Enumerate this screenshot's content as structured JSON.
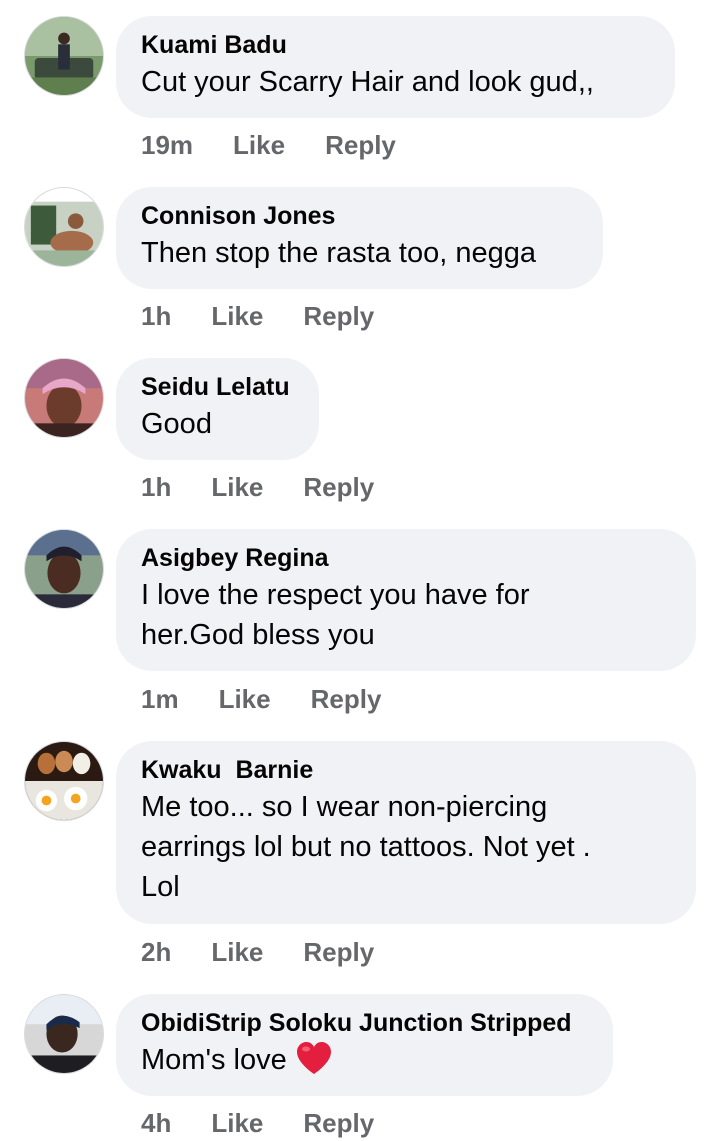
{
  "comments": [
    {
      "author": "Kuami Badu",
      "text": "Cut your Scarry Hair and look gud,,",
      "time": "19m",
      "like_label": "Like",
      "reply_label": "Reply",
      "avatar_desc": "man-standing-by-car-avatar"
    },
    {
      "author": "Connison Jones",
      "text": "Then stop the rasta too, negga",
      "time": "1h",
      "like_label": "Like",
      "reply_label": "Reply",
      "avatar_desc": "person-sitting-avatar"
    },
    {
      "author": "Seidu Lelatu",
      "text": "Good",
      "time": "1h",
      "like_label": "Like",
      "reply_label": "Reply",
      "avatar_desc": "woman-headwrap-avatar"
    },
    {
      "author": "Asigbey Regina",
      "text_lines": [
        "I love the respect you have for",
        "her.God bless you"
      ],
      "time": "1m",
      "like_label": "Like",
      "reply_label": "Reply",
      "avatar_desc": "woman-portrait-avatar"
    },
    {
      "author": "Kwaku  Barnie",
      "text_lines": [
        "Me too... so I wear non-piercing",
        "earrings lol but no tattoos. Not yet .",
        "Lol"
      ],
      "time": "2h",
      "like_label": "Like",
      "reply_label": "Reply",
      "avatar_desc": "eggs-avatar"
    },
    {
      "author": "ObidiStrip Soloku Junction Stripped",
      "text": "Mom's love",
      "emoji": "heart-icon",
      "time": "4h",
      "like_label": "Like",
      "reply_label": "Reply",
      "avatar_desc": "man-portrait-avatar"
    }
  ],
  "colors": {
    "bubble": "#f0f2f5",
    "meta": "#65676b",
    "text": "#050505",
    "heart": "#e41e3f"
  }
}
